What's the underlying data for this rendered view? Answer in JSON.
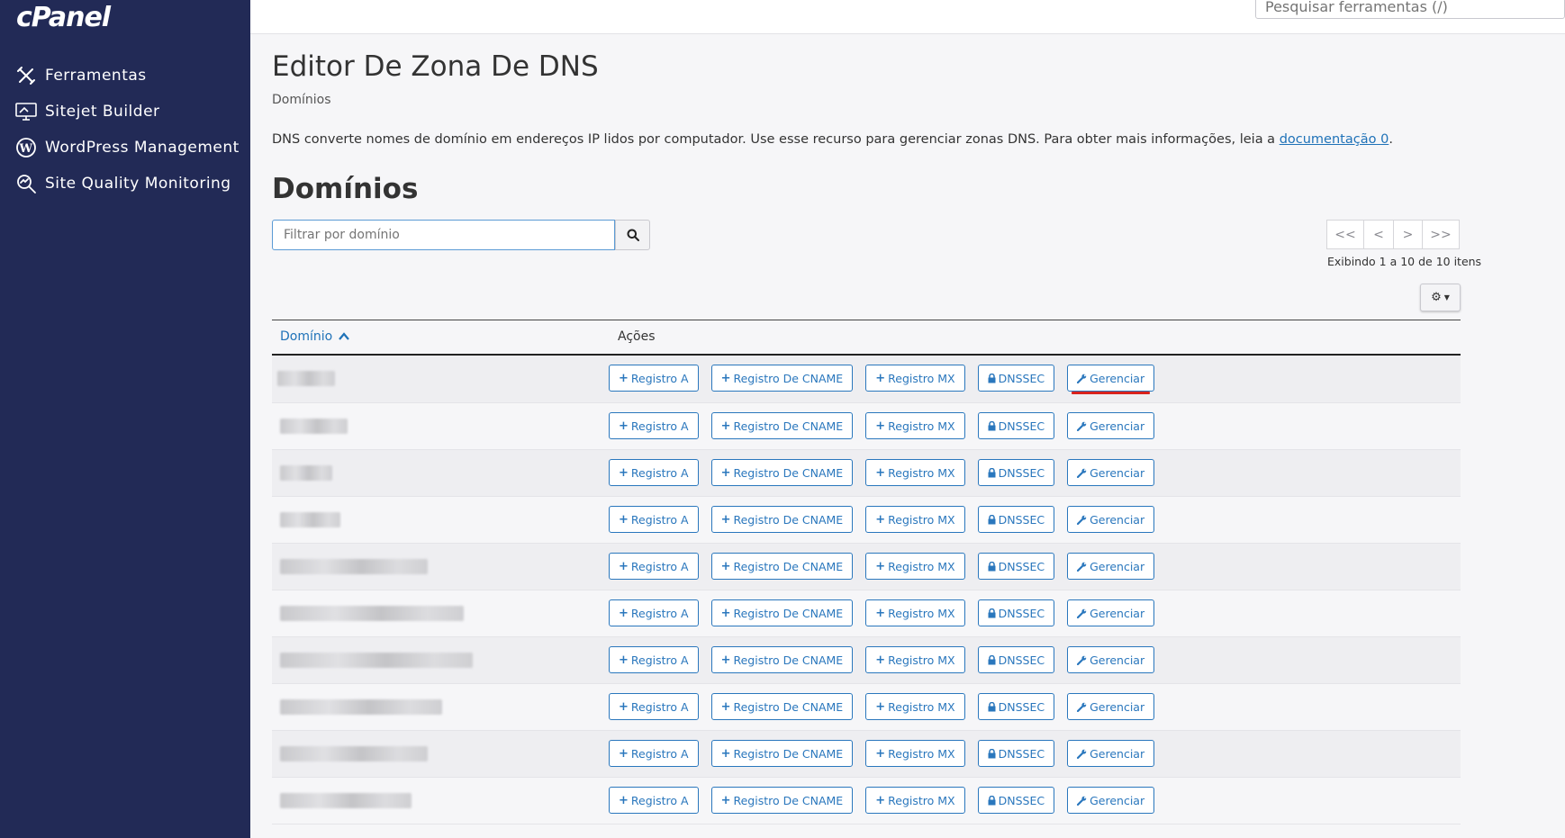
{
  "sidebar": {
    "logo": "cPanel",
    "items": [
      {
        "label": "Ferramentas",
        "icon": "tools-icon"
      },
      {
        "label": "Sitejet Builder",
        "icon": "monitor-icon"
      },
      {
        "label": "WordPress Management",
        "icon": "wordpress-icon"
      },
      {
        "label": "Site Quality Monitoring",
        "icon": "magnifier-icon"
      }
    ]
  },
  "topbar": {
    "search_placeholder": "Pesquisar ferramentas (/)"
  },
  "page": {
    "title": "Editor De Zona De DNS",
    "breadcrumb": "Domínios",
    "description": "DNS converte nomes de domínio em endereços IP lidos por computador. Use esse recurso para gerenciar zonas DNS. Para obter mais informações, leia a ",
    "doc_link": "documentação",
    "doc_link_icon": "0",
    "description_end": ".",
    "section_title": "Domínios"
  },
  "filter": {
    "placeholder": "Filtrar por domínio"
  },
  "pagination": {
    "first": "<<",
    "prev": "<",
    "next": ">",
    "last": ">>",
    "showing": "Exibindo 1 a 10 de 10 itens"
  },
  "table": {
    "col_domain": "Domínio",
    "col_actions": "Ações",
    "buttons": {
      "a_record": "Registro A",
      "cname_record": "Registro De CNAME",
      "mx_record": "Registro MX",
      "dnssec": "DNSSEC",
      "manage": "Gerenciar"
    },
    "row_count": 10
  },
  "colors": {
    "sidebar_bg": "#222a56",
    "accent": "#2a77bd",
    "highlight_underline": "#d9221c"
  }
}
